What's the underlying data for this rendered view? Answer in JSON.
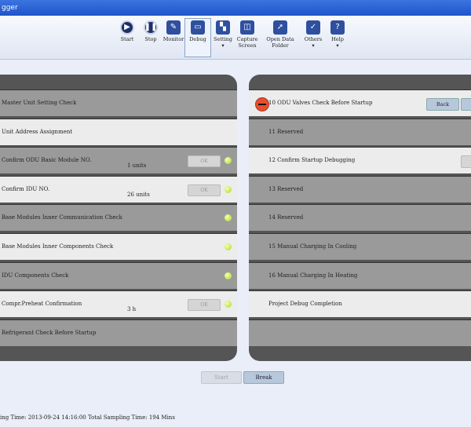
{
  "window": {
    "title_fragment": "gger"
  },
  "toolbar": {
    "buttons": [
      {
        "id": "start",
        "label": "Start",
        "icon": "play-icon"
      },
      {
        "id": "stop",
        "label": "Stop",
        "icon": "pause-icon"
      },
      {
        "id": "monitor",
        "label": "Monitor",
        "icon": "monitor-doc-icon"
      },
      {
        "id": "debug",
        "label": "Debug",
        "icon": "computer-icon",
        "active": true
      },
      {
        "id": "setting",
        "label": "Setting\n▾",
        "icon": "settings-icon"
      },
      {
        "id": "capture",
        "label": "Capture\nScreen",
        "icon": "capture-icon"
      },
      {
        "id": "open_data",
        "label": "Open Data\nFolder",
        "icon": "folder-icon"
      },
      {
        "id": "others",
        "label": "Others\n▾",
        "icon": "others-icon"
      },
      {
        "id": "help",
        "label": "Help\n▾",
        "icon": "help-icon"
      }
    ]
  },
  "left_panel": {
    "rows": [
      {
        "label": "Master Unit Setting Check",
        "shade": "dark"
      },
      {
        "label": "Unit Address Assignment",
        "shade": "light"
      },
      {
        "label": "Confirm ODU Basic Module NO.",
        "shade": "dark",
        "value": "1 units",
        "ok": "OK",
        "led": true
      },
      {
        "label": "Confirm IDU NO.",
        "shade": "light",
        "value": "26 units",
        "ok": "OK",
        "led": true
      },
      {
        "label": "Base Modules Inner Communication Check",
        "shade": "dark",
        "led": true
      },
      {
        "label": "Base Modules Inner Components Check",
        "shade": "light",
        "led": true
      },
      {
        "label": "IDU Components Check",
        "shade": "dark",
        "led": true
      },
      {
        "label": "Compr.Preheat Confirmation",
        "shade": "light",
        "value": "3 h",
        "ok": "OK",
        "led": true
      },
      {
        "label": "Refrigerant Check Before Startup",
        "shade": "dark"
      }
    ]
  },
  "right_panel": {
    "rows": [
      {
        "label": "10 ODU Valves Check Before Startup",
        "shade": "light",
        "stop": true,
        "back": "Back"
      },
      {
        "label": "11  Reserved",
        "shade": "dark"
      },
      {
        "label": "12 Confirm Startup Debugging",
        "shade": "light"
      },
      {
        "label": "13 Reserved",
        "shade": "dark"
      },
      {
        "label": "14 Reserved",
        "shade": "dark"
      },
      {
        "label": "15 Manual Charging In Cooling",
        "shade": "dark"
      },
      {
        "label": "16 Manual Charging In Heating",
        "shade": "dark"
      },
      {
        "label": "Project Debug Completion",
        "shade": "light"
      },
      {
        "label": "",
        "shade": "dark"
      }
    ]
  },
  "bottom": {
    "start_label": "Start",
    "break_label": "Break"
  },
  "status": {
    "text": "ing Time: 2013-09-24 14:16:00  Total Sampling Time: 194 Mins"
  }
}
